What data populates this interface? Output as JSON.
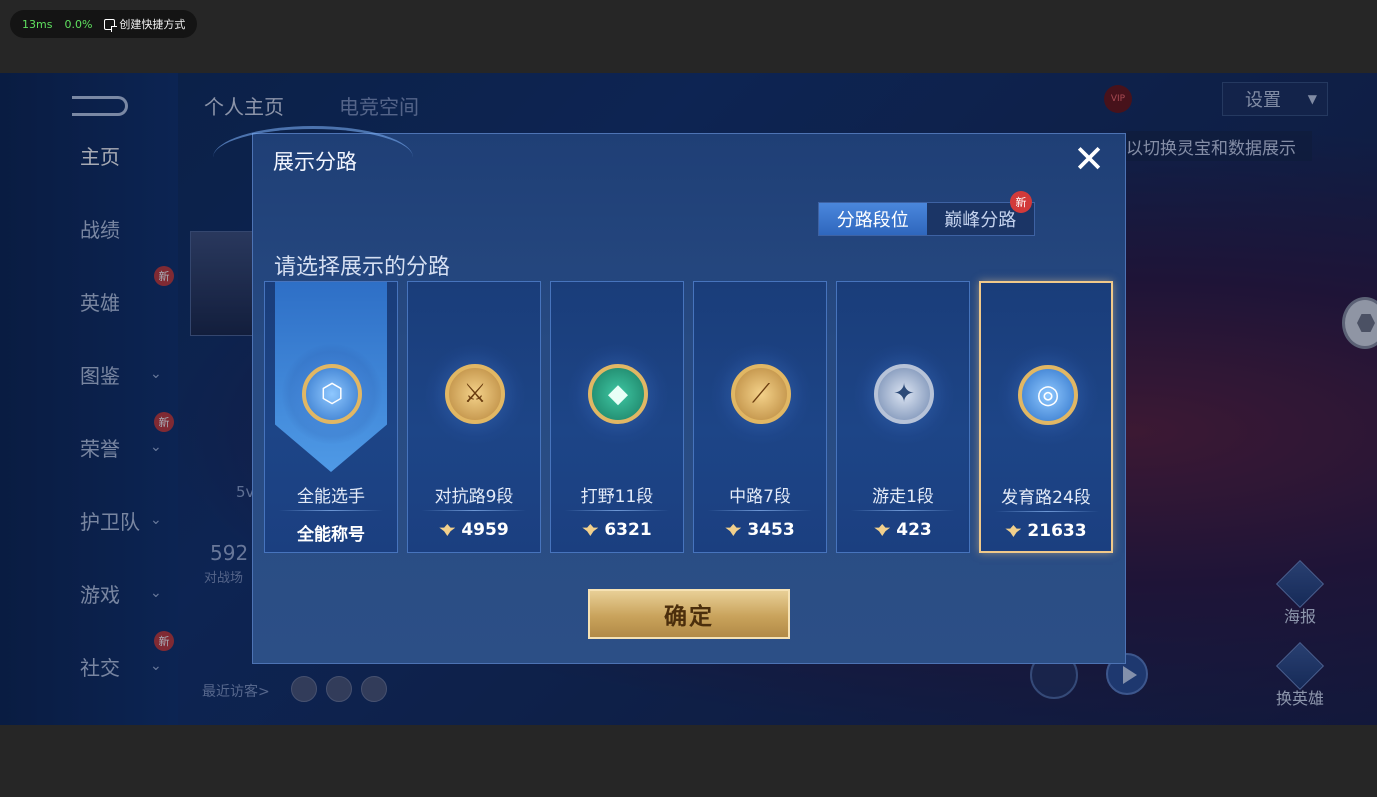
{
  "overlay": {
    "ms": "13ms",
    "cpu": "0.0%",
    "shortcut_label": "创建快捷方式"
  },
  "nav": {
    "items": [
      {
        "label": "主页",
        "new": false,
        "chev": false
      },
      {
        "label": "战绩",
        "new": false,
        "chev": false
      },
      {
        "label": "英雄",
        "new": true,
        "chev": false
      },
      {
        "label": "图鉴",
        "new": false,
        "chev": true
      },
      {
        "label": "荣誉",
        "new": true,
        "chev": true
      },
      {
        "label": "护卫队",
        "new": false,
        "chev": true
      },
      {
        "label": "游戏",
        "new": false,
        "chev": true
      },
      {
        "label": "社交",
        "new": true,
        "chev": true
      }
    ],
    "new_label": "新"
  },
  "header": {
    "tab_profile": "个人主页",
    "tab_esports": "电竞空间",
    "settings": "设置",
    "hint": "以切换灵宝和数据展示",
    "vip": "VIP"
  },
  "background": {
    "stat_value": "592",
    "stat_label": "对战场",
    "mode_label": "5v",
    "recent": "最近访客>",
    "poster": "海报",
    "change_hero": "换英雄",
    "new_label": "新"
  },
  "modal": {
    "title": "展示分路",
    "close": "✕",
    "seg_active": "分路段位",
    "seg_peak": "巅峰分路",
    "seg_new": "新",
    "prompt": "请选择展示的分路",
    "confirm": "确定",
    "cards": [
      {
        "name": "全能选手",
        "score": "全能称号",
        "emblem": "⬡",
        "style": "blue",
        "selected": false,
        "first": true
      },
      {
        "name": "对抗路9段",
        "score": "4959",
        "emblem": "⚔",
        "style": "gold",
        "selected": false,
        "first": false
      },
      {
        "name": "打野11段",
        "score": "6321",
        "emblem": "◆",
        "style": "teal",
        "selected": false,
        "first": false
      },
      {
        "name": "中路7段",
        "score": "3453",
        "emblem": "⟋",
        "style": "gold",
        "selected": false,
        "first": false
      },
      {
        "name": "游走1段",
        "score": "423",
        "emblem": "✦",
        "style": "silver",
        "selected": false,
        "first": false
      },
      {
        "name": "发育路24段",
        "score": "21633",
        "emblem": "◎",
        "style": "blue",
        "selected": true,
        "first": false
      }
    ]
  }
}
